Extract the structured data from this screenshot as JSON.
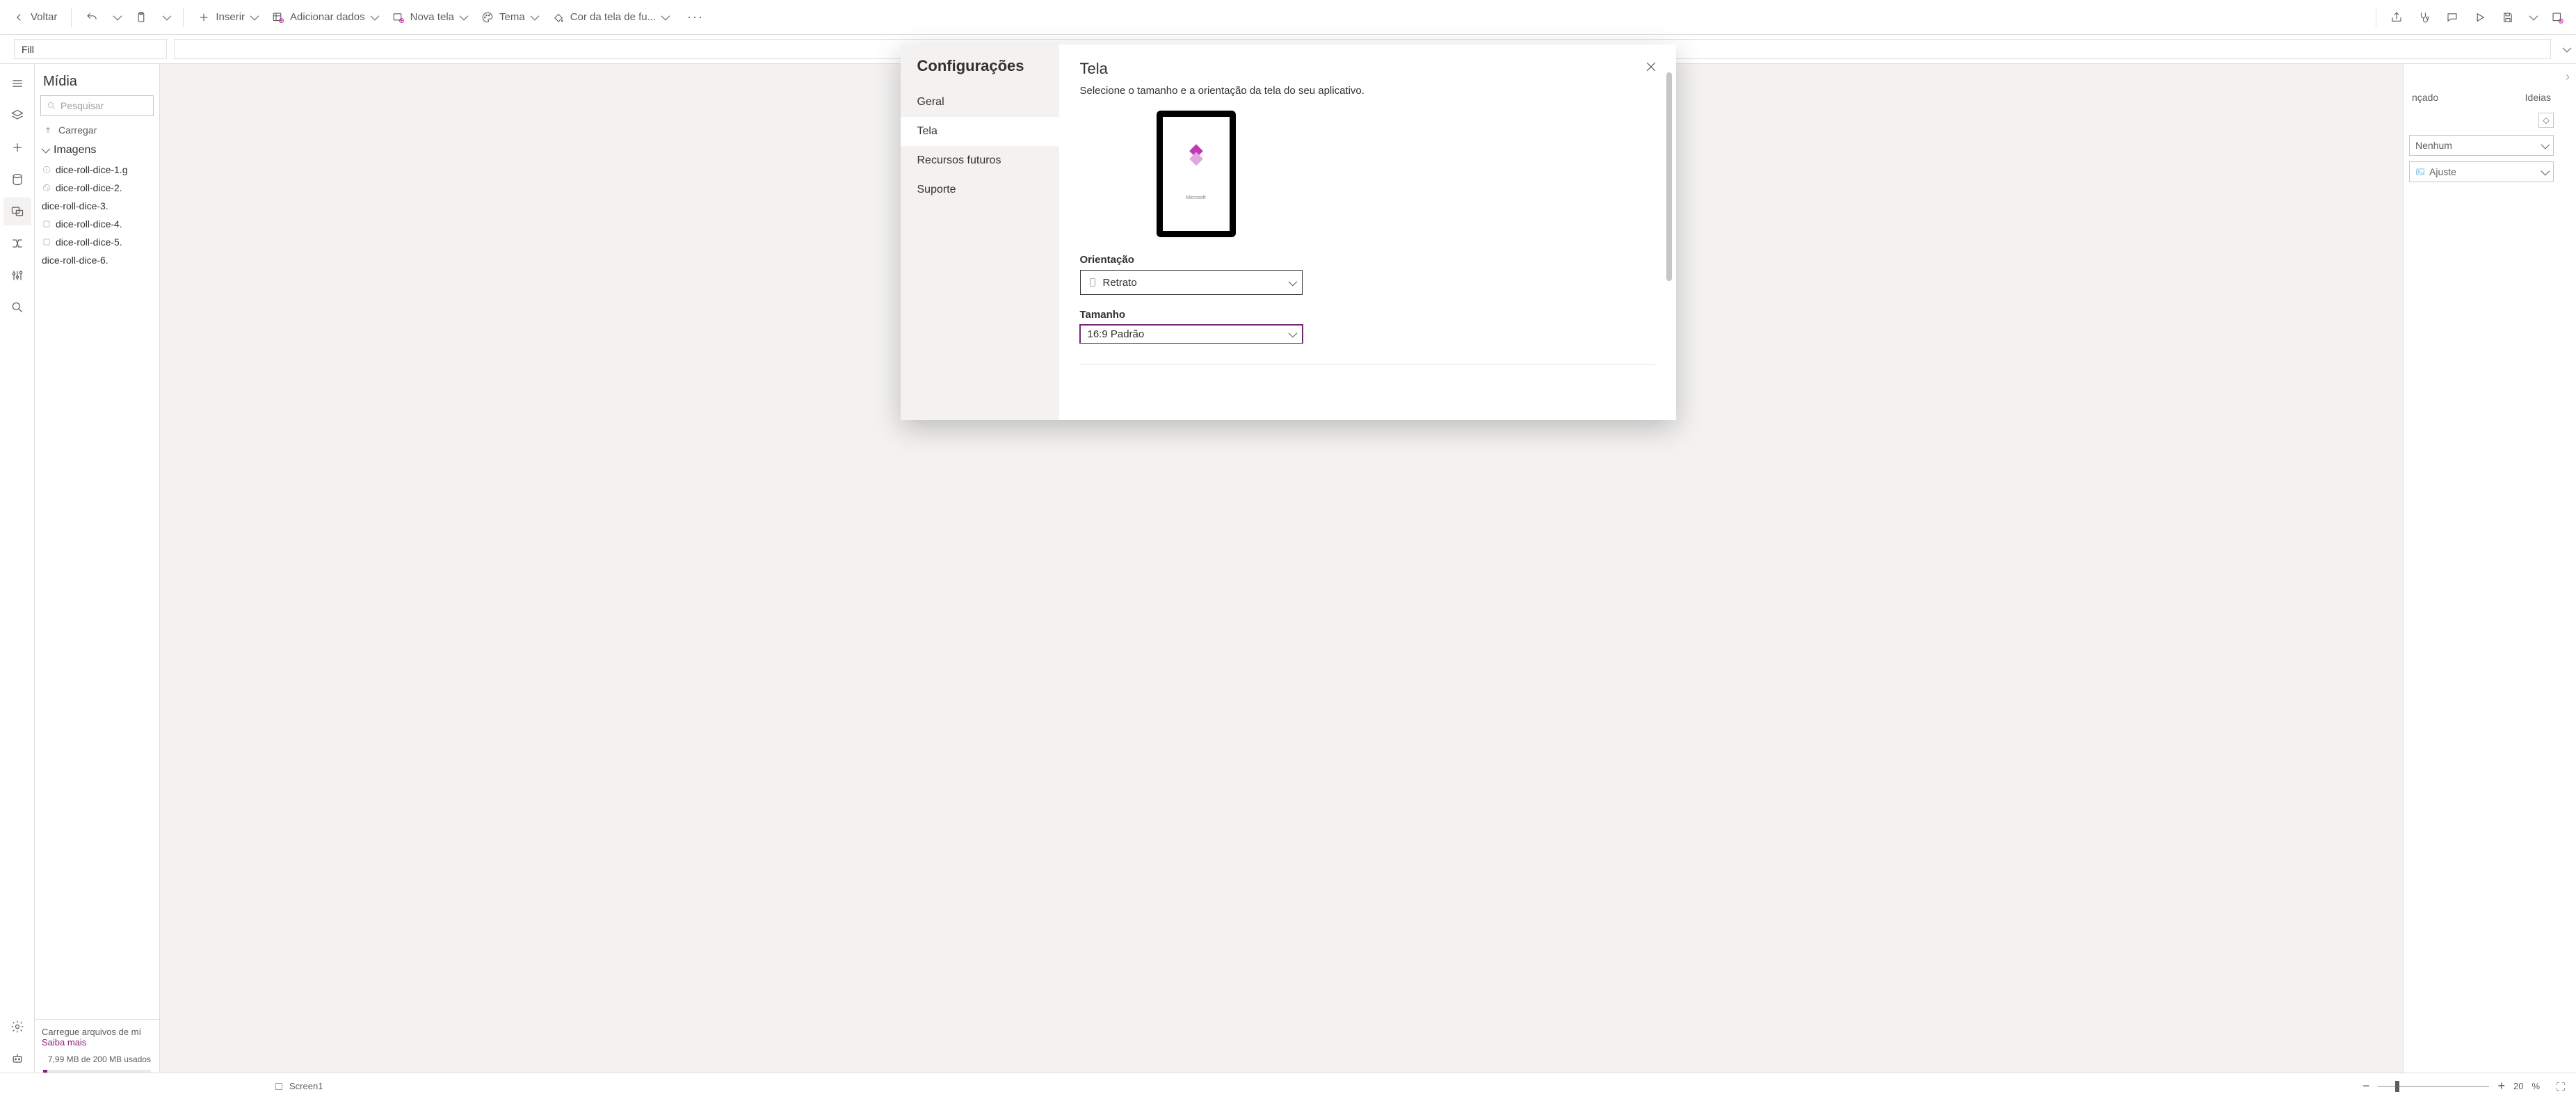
{
  "toolbar": {
    "back": "Voltar",
    "insert": "Inserir",
    "add_data": "Adicionar dados",
    "new_screen": "Nova tela",
    "theme": "Tema",
    "bg_color": "Cor da tela de fu..."
  },
  "formula": {
    "property": "Fill"
  },
  "media_panel": {
    "title": "Mídia",
    "search_placeholder": "Pesquisar",
    "upload": "Carregar",
    "group": "Imagens",
    "items": [
      "dice-roll-dice-1.g",
      "dice-roll-dice-2.",
      "dice-roll-dice-3.",
      "dice-roll-dice-4.",
      "dice-roll-dice-5.",
      "dice-roll-dice-6."
    ],
    "foot_line1": "Carregue arquivos de mí",
    "foot_link": "Saiba mais",
    "usage": "7,99 MB de 200 MB usados"
  },
  "props": {
    "tab_adv": "nçado",
    "tab_ideas": "Ideias",
    "dd1": "Nenhum",
    "dd2": "Ajuste"
  },
  "status": {
    "screen": "Screen1",
    "zoom_value": "20",
    "zoom_unit": "%"
  },
  "modal": {
    "title": "Configurações",
    "nav": {
      "general": "Geral",
      "screen": "Tela",
      "future": "Recursos futuros",
      "support": "Suporte"
    },
    "content": {
      "heading": "Tela",
      "subtitle": "Selecione o tamanho e a orientação da tela do seu aplicativo.",
      "orientation_label": "Orientação",
      "orientation_value": "Retrato",
      "size_label": "Tamanho",
      "size_value": "16:9 Padrão",
      "ms_label": "Microsoft"
    }
  }
}
